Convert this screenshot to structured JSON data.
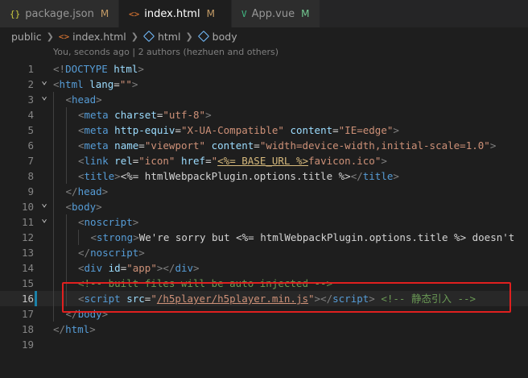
{
  "tabs": [
    {
      "icon": "{}",
      "name": "package.json",
      "status": "M",
      "active": false,
      "icon_color": "#cbcb41"
    },
    {
      "icon": "<>",
      "name": "index.html",
      "status": "M",
      "active": true,
      "icon_color": "#e37933"
    },
    {
      "icon": "V",
      "name": "App.vue",
      "status": "M",
      "active": false,
      "icon_color": "#41b883"
    }
  ],
  "breadcrumb": {
    "folder": "public",
    "file": "index.html",
    "items": [
      "html",
      "body"
    ]
  },
  "blame": "You, seconds ago | 2 authors (hezhuen and others)",
  "current_line": 16,
  "colors": {
    "tag": "#569cd6",
    "bracket": "#808080",
    "attr": "#9cdcfe",
    "string": "#ce9178",
    "text": "#d4d4d4",
    "comment": "#6a9955",
    "template": "#d7ba7d",
    "highlight_box": "#e0201f"
  },
  "lines": [
    {
      "n": 1,
      "fold": "",
      "indent": 0,
      "tokens": [
        [
          "p",
          "<!"
        ],
        [
          "t",
          "DOCTYPE"
        ],
        [
          "x",
          " "
        ],
        [
          "a",
          "html"
        ],
        [
          "p",
          ">"
        ]
      ]
    },
    {
      "n": 2,
      "fold": "v",
      "indent": 0,
      "tokens": [
        [
          "p",
          "<"
        ],
        [
          "t",
          "html"
        ],
        [
          "x",
          " "
        ],
        [
          "a",
          "lang"
        ],
        [
          "x",
          "="
        ],
        [
          "s",
          "\"\""
        ],
        [
          "p",
          ">"
        ]
      ]
    },
    {
      "n": 3,
      "fold": "v",
      "indent": 1,
      "tokens": [
        [
          "p",
          "<"
        ],
        [
          "t",
          "head"
        ],
        [
          "p",
          ">"
        ]
      ]
    },
    {
      "n": 4,
      "fold": "",
      "indent": 2,
      "tokens": [
        [
          "p",
          "<"
        ],
        [
          "t",
          "meta"
        ],
        [
          "x",
          " "
        ],
        [
          "a",
          "charset"
        ],
        [
          "x",
          "="
        ],
        [
          "s",
          "\"utf-8\""
        ],
        [
          "p",
          ">"
        ]
      ]
    },
    {
      "n": 5,
      "fold": "",
      "indent": 2,
      "tokens": [
        [
          "p",
          "<"
        ],
        [
          "t",
          "meta"
        ],
        [
          "x",
          " "
        ],
        [
          "a",
          "http-equiv"
        ],
        [
          "x",
          "="
        ],
        [
          "s",
          "\"X-UA-Compatible\""
        ],
        [
          "x",
          " "
        ],
        [
          "a",
          "content"
        ],
        [
          "x",
          "="
        ],
        [
          "s",
          "\"IE=edge\""
        ],
        [
          "p",
          ">"
        ]
      ]
    },
    {
      "n": 6,
      "fold": "",
      "indent": 2,
      "tokens": [
        [
          "p",
          "<"
        ],
        [
          "t",
          "meta"
        ],
        [
          "x",
          " "
        ],
        [
          "a",
          "name"
        ],
        [
          "x",
          "="
        ],
        [
          "s",
          "\"viewport\""
        ],
        [
          "x",
          " "
        ],
        [
          "a",
          "content"
        ],
        [
          "x",
          "="
        ],
        [
          "s",
          "\"width=device-width,initial-scale=1.0\""
        ],
        [
          "p",
          ">"
        ]
      ]
    },
    {
      "n": 7,
      "fold": "",
      "indent": 2,
      "tokens": [
        [
          "p",
          "<"
        ],
        [
          "t",
          "link"
        ],
        [
          "x",
          " "
        ],
        [
          "a",
          "rel"
        ],
        [
          "x",
          "="
        ],
        [
          "s",
          "\"icon\""
        ],
        [
          "x",
          " "
        ],
        [
          "a",
          "href"
        ],
        [
          "x",
          "="
        ],
        [
          "s",
          "\""
        ],
        [
          "u",
          "<%= BASE_URL %>"
        ],
        [
          "s",
          "favicon.ico\""
        ],
        [
          "p",
          ">"
        ]
      ]
    },
    {
      "n": 8,
      "fold": "",
      "indent": 2,
      "tokens": [
        [
          "p",
          "<"
        ],
        [
          "t",
          "title"
        ],
        [
          "p",
          ">"
        ],
        [
          "x",
          "<%= htmlWebpackPlugin.options.title %>"
        ],
        [
          "p",
          "</"
        ],
        [
          "t",
          "title"
        ],
        [
          "p",
          ">"
        ]
      ]
    },
    {
      "n": 9,
      "fold": "",
      "indent": 1,
      "tokens": [
        [
          "p",
          "</"
        ],
        [
          "t",
          "head"
        ],
        [
          "p",
          ">"
        ]
      ]
    },
    {
      "n": 10,
      "fold": "v",
      "indent": 1,
      "tokens": [
        [
          "p",
          "<"
        ],
        [
          "t",
          "body"
        ],
        [
          "p",
          ">"
        ]
      ]
    },
    {
      "n": 11,
      "fold": "v",
      "indent": 2,
      "tokens": [
        [
          "p",
          "<"
        ],
        [
          "t",
          "noscript"
        ],
        [
          "p",
          ">"
        ]
      ]
    },
    {
      "n": 12,
      "fold": "",
      "indent": 3,
      "tokens": [
        [
          "p",
          "<"
        ],
        [
          "t",
          "strong"
        ],
        [
          "p",
          ">"
        ],
        [
          "x",
          "We're sorry but <%= htmlWebpackPlugin.options.title %> doesn't"
        ]
      ]
    },
    {
      "n": 13,
      "fold": "",
      "indent": 2,
      "tokens": [
        [
          "p",
          "</"
        ],
        [
          "t",
          "noscript"
        ],
        [
          "p",
          ">"
        ]
      ]
    },
    {
      "n": 14,
      "fold": "",
      "indent": 2,
      "tokens": [
        [
          "p",
          "<"
        ],
        [
          "t",
          "div"
        ],
        [
          "x",
          " "
        ],
        [
          "a",
          "id"
        ],
        [
          "x",
          "="
        ],
        [
          "s",
          "\"app\""
        ],
        [
          "p",
          "></"
        ],
        [
          "t",
          "div"
        ],
        [
          "p",
          ">"
        ]
      ]
    },
    {
      "n": 15,
      "fold": "",
      "indent": 2,
      "tokens": [
        [
          "c",
          "<!-- built files will be auto injected -->"
        ]
      ]
    },
    {
      "n": 16,
      "fold": "",
      "indent": 2,
      "tokens": [
        [
          "p",
          "<"
        ],
        [
          "t",
          "script"
        ],
        [
          "x",
          " "
        ],
        [
          "a",
          "src"
        ],
        [
          "x",
          "="
        ],
        [
          "s",
          "\""
        ],
        [
          "su",
          "/h5player/h5player.min.js"
        ],
        [
          "s",
          "\""
        ],
        [
          "p",
          "></"
        ],
        [
          "t",
          "script"
        ],
        [
          "p",
          ">"
        ],
        [
          "x",
          " "
        ],
        [
          "c",
          "<!-- 静态引入 -->"
        ]
      ]
    },
    {
      "n": 17,
      "fold": "",
      "indent": 1,
      "tokens": [
        [
          "p",
          "</"
        ],
        [
          "t",
          "body"
        ],
        [
          "p",
          ">"
        ]
      ]
    },
    {
      "n": 18,
      "fold": "",
      "indent": 0,
      "tokens": [
        [
          "p",
          "</"
        ],
        [
          "t",
          "html"
        ],
        [
          "p",
          ">"
        ]
      ]
    },
    {
      "n": 19,
      "fold": "",
      "indent": 0,
      "tokens": []
    }
  ]
}
